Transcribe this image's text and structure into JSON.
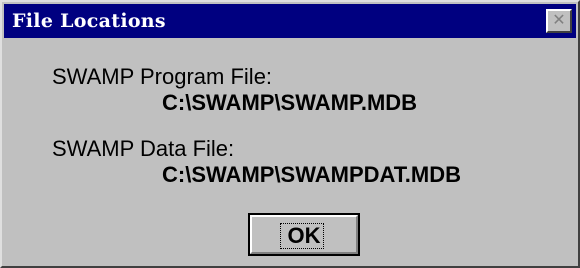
{
  "window": {
    "title": "File Locations",
    "close_symbol": "✕",
    "close_icon": "close-icon"
  },
  "content": {
    "program_label": "SWAMP Program File:",
    "program_path": "C:\\SWAMP\\SWAMP.MDB",
    "data_label": "SWAMP Data File:",
    "data_path": "C:\\SWAMP\\SWAMPDAT.MDB"
  },
  "buttons": {
    "ok_label": "OK"
  },
  "colors": {
    "titlebar": "#000080",
    "face": "#c0c0c0"
  }
}
